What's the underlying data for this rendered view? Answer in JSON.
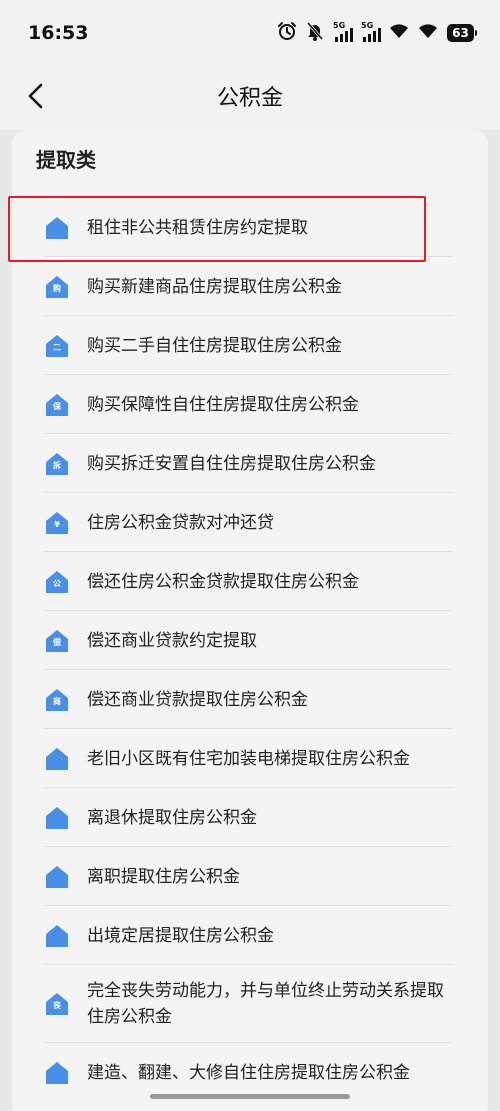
{
  "status_bar": {
    "time": "16:53",
    "signal_1_label": "5G",
    "signal_2_label": "5G",
    "battery": "63"
  },
  "header": {
    "title": "公积金"
  },
  "section": {
    "title": "提取类"
  },
  "accent_color": "#4a8fe7",
  "highlight_color": "#e02020",
  "items": [
    {
      "label": "租住非公共租赁住房约定提取",
      "icon_glyph": "",
      "icon": "key-house-icon"
    },
    {
      "label": "购买新建商品住房提取住房公积金",
      "icon_glyph": "购",
      "icon": "house-buy-icon"
    },
    {
      "label": "购买二手自住住房提取住房公积金",
      "icon_glyph": "二",
      "icon": "house-second-hand-icon"
    },
    {
      "label": "购买保障性自住住房提取住房公积金",
      "icon_glyph": "保",
      "icon": "house-affordable-icon"
    },
    {
      "label": "购买拆迁安置自住住房提取住房公积金",
      "icon_glyph": "拆",
      "icon": "house-relocation-icon"
    },
    {
      "label": "住房公积金贷款对冲还贷",
      "icon_glyph": "¥",
      "icon": "house-yuan-icon"
    },
    {
      "label": "偿还住房公积金贷款提取住房公积金",
      "icon_glyph": "公",
      "icon": "house-public-loan-icon"
    },
    {
      "label": "偿还商业贷款约定提取",
      "icon_glyph": "偿",
      "icon": "house-repay-icon"
    },
    {
      "label": "偿还商业贷款提取住房公积金",
      "icon_glyph": "商",
      "icon": "house-commercial-icon"
    },
    {
      "label": "老旧小区既有住宅加装电梯提取住房公积金",
      "icon_glyph": "",
      "icon": "house-elevator-icon"
    },
    {
      "label": "离退休提取住房公积金",
      "icon_glyph": "",
      "icon": "house-retire-icon"
    },
    {
      "label": "离职提取住房公积金",
      "icon_glyph": "",
      "icon": "house-resign-icon"
    },
    {
      "label": "出境定居提取住房公积金",
      "icon_glyph": "",
      "icon": "house-plane-icon"
    },
    {
      "label": "完全丧失劳动能力，并与单位终止劳动关系提取住房公积金",
      "icon_glyph": "丧",
      "icon": "house-disability-icon"
    },
    {
      "label": "建造、翻建、大修自住住房提取住房公积金",
      "icon_glyph": "",
      "icon": "house-build-icon"
    }
  ]
}
